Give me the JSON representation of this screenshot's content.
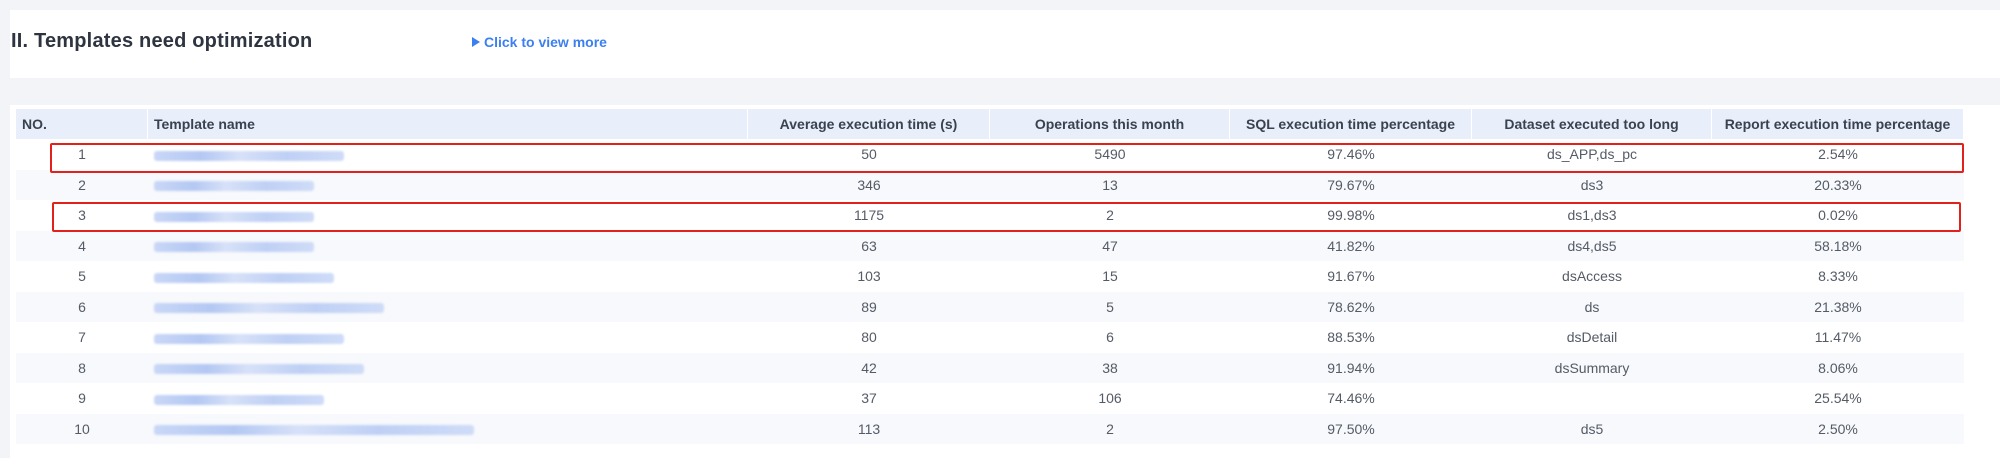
{
  "section": {
    "title": "II. Templates need optimization",
    "view_more": "Click to view more"
  },
  "table": {
    "columns": [
      "NO.",
      "Template name",
      "Average execution time (s)",
      "Operations this month",
      "SQL execution time percentage",
      "Dataset executed too long",
      "Report execution time percentage"
    ],
    "rows": [
      {
        "no": "1",
        "name": "",
        "avg": "50",
        "ops": "5490",
        "sql": "97.46%",
        "dataset": "ds_APP,ds_pc",
        "report": "2.54%"
      },
      {
        "no": "2",
        "name": "",
        "avg": "346",
        "ops": "13",
        "sql": "79.67%",
        "dataset": "ds3",
        "report": "20.33%"
      },
      {
        "no": "3",
        "name": "",
        "avg": "1175",
        "ops": "2",
        "sql": "99.98%",
        "dataset": "ds1,ds3",
        "report": "0.02%"
      },
      {
        "no": "4",
        "name": "",
        "avg": "63",
        "ops": "47",
        "sql": "41.82%",
        "dataset": "ds4,ds5",
        "report": "58.18%"
      },
      {
        "no": "5",
        "name": "",
        "avg": "103",
        "ops": "15",
        "sql": "91.67%",
        "dataset": "dsAccess",
        "report": "8.33%"
      },
      {
        "no": "6",
        "name": "",
        "avg": "89",
        "ops": "5",
        "sql": "78.62%",
        "dataset": "ds",
        "report": "21.38%"
      },
      {
        "no": "7",
        "name": "",
        "avg": "80",
        "ops": "6",
        "sql": "88.53%",
        "dataset": "dsDetail",
        "report": "11.47%"
      },
      {
        "no": "8",
        "name": "",
        "avg": "42",
        "ops": "38",
        "sql": "91.94%",
        "dataset": "dsSummary",
        "report": "8.06%"
      },
      {
        "no": "9",
        "name": "",
        "avg": "37",
        "ops": "106",
        "sql": "74.46%",
        "dataset": "",
        "report": "25.54%"
      },
      {
        "no": "10",
        "name": "",
        "avg": "113",
        "ops": "2",
        "sql": "97.50%",
        "dataset": "ds5",
        "report": "2.50%"
      }
    ]
  },
  "colors": {
    "accent": "#3b7ff0",
    "highlight": "#e2211c",
    "header_bg": "#e8effb"
  },
  "icons": {
    "view_more": "play-triangle-icon"
  }
}
